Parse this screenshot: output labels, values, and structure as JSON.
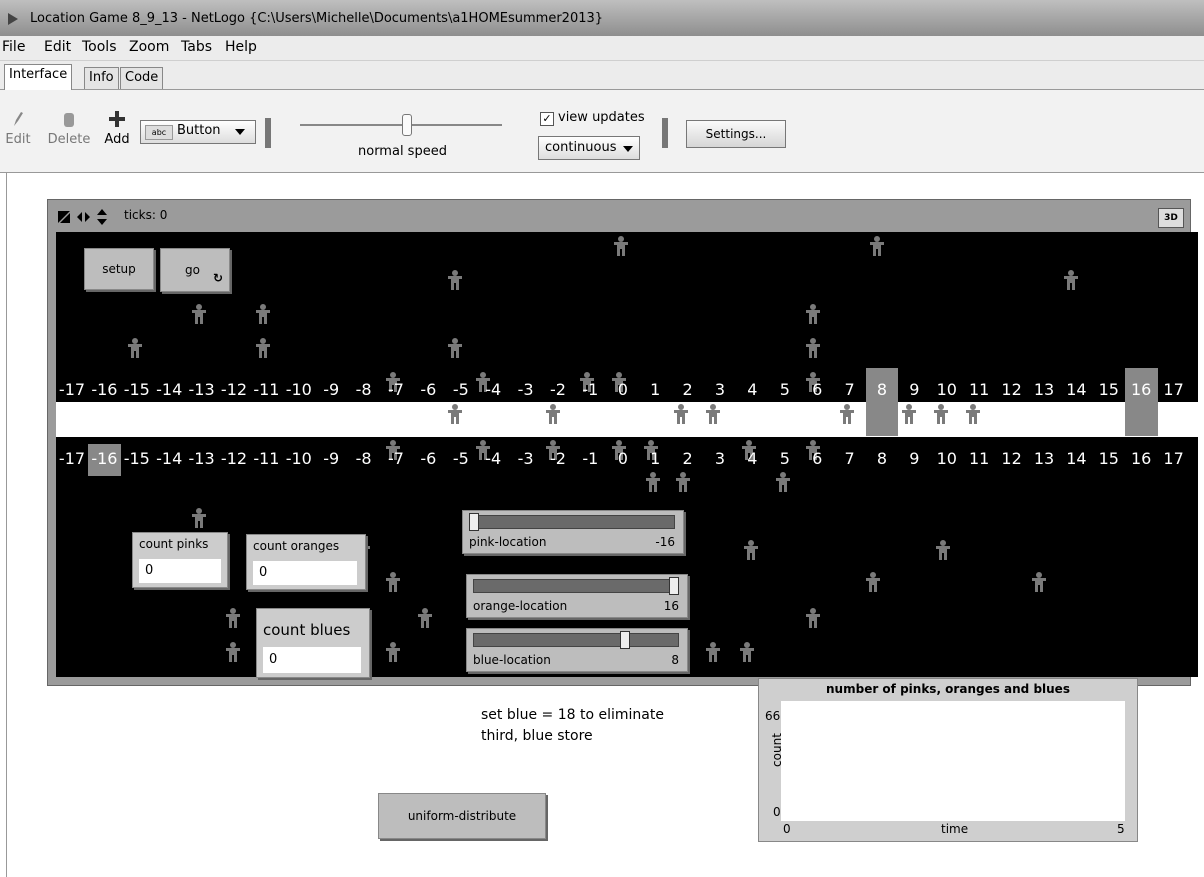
{
  "window": {
    "title": "Location Game 8_9_13 - NetLogo {C:\\Users\\Michelle\\Documents\\a1HOMEsummer2013}"
  },
  "menu": [
    "File",
    "Edit",
    "Tools",
    "Zoom",
    "Tabs",
    "Help"
  ],
  "tabs": [
    {
      "label": "Interface",
      "active": true
    },
    {
      "label": "Info"
    },
    {
      "label": "Code"
    }
  ],
  "toolbar": {
    "edit_label": "Edit",
    "delete_label": "Delete",
    "add_label": "Add",
    "widget_type": "Button",
    "widget_icon_text": "abc",
    "speed_label": "normal speed",
    "view_updates_label": "view updates",
    "view_updates_checked": true,
    "view_updates_check": "✓",
    "update_mode": "continuous",
    "settings_label": "Settings..."
  },
  "view": {
    "ticks_text": "ticks: 0",
    "three_d_label": "3D",
    "top_numbers": [
      "-17",
      "-16",
      "-15",
      "-14",
      "-13",
      "-12",
      "-11",
      "-10",
      "-9",
      "-8",
      "-7",
      "-6",
      "-5",
      "-4",
      "-3",
      "-2",
      "-1",
      "0",
      "1",
      "2",
      "3",
      "4",
      "5",
      "6",
      "7",
      "8",
      "9",
      "10",
      "11",
      "12",
      "13",
      "14",
      "15",
      "16",
      "17"
    ],
    "bottom_numbers": [
      "-17",
      "-16",
      "-15",
      "-14",
      "-13",
      "-12",
      "-11",
      "-10",
      "-9",
      "-8",
      "-7",
      "-6",
      "-5",
      "-4",
      "-3",
      "-2",
      "-1",
      "0",
      "1",
      "2",
      "3",
      "4",
      "5",
      "6",
      "7",
      "8",
      "9",
      "10",
      "11",
      "12",
      "13",
      "14",
      "15",
      "16",
      "17"
    ],
    "top_highlights": [
      "8",
      "16"
    ],
    "bottom_highlights": [
      "-16"
    ]
  },
  "widgets": {
    "setup_label": "setup",
    "go_label": "go",
    "go_forever_icon": "↻",
    "count_pinks_label": "count pinks",
    "count_pinks_value": "0",
    "count_oranges_label": "count oranges",
    "count_oranges_value": "0",
    "count_blues_label": "count blues",
    "count_blues_value": "0",
    "pink_slider": {
      "label": "pink-location",
      "value": "-16",
      "min": -16,
      "max": 16
    },
    "orange_slider": {
      "label": "orange-location",
      "value": "16",
      "min": -16,
      "max": 16
    },
    "blue_slider": {
      "label": "blue-location",
      "value": "8",
      "min": -16,
      "max": 16
    },
    "uniform_label": "uniform-distribute"
  },
  "note": {
    "line1": "set blue = 18 to eliminate",
    "line2": "third, blue store"
  },
  "plot": {
    "title": "number of pinks, oranges and blues",
    "y_label": "count",
    "x_label": "time",
    "y_max": "66",
    "y_min": "0",
    "x_min": "0",
    "x_max": "5"
  },
  "colors": {
    "world_bg": "#000000",
    "patch_highlight": "#888888",
    "widget_bg": "#bdbdbd"
  },
  "icons": {
    "edit": "pencil-icon",
    "delete": "trash-icon",
    "add": "plus-icon",
    "go": "forever-icon"
  }
}
